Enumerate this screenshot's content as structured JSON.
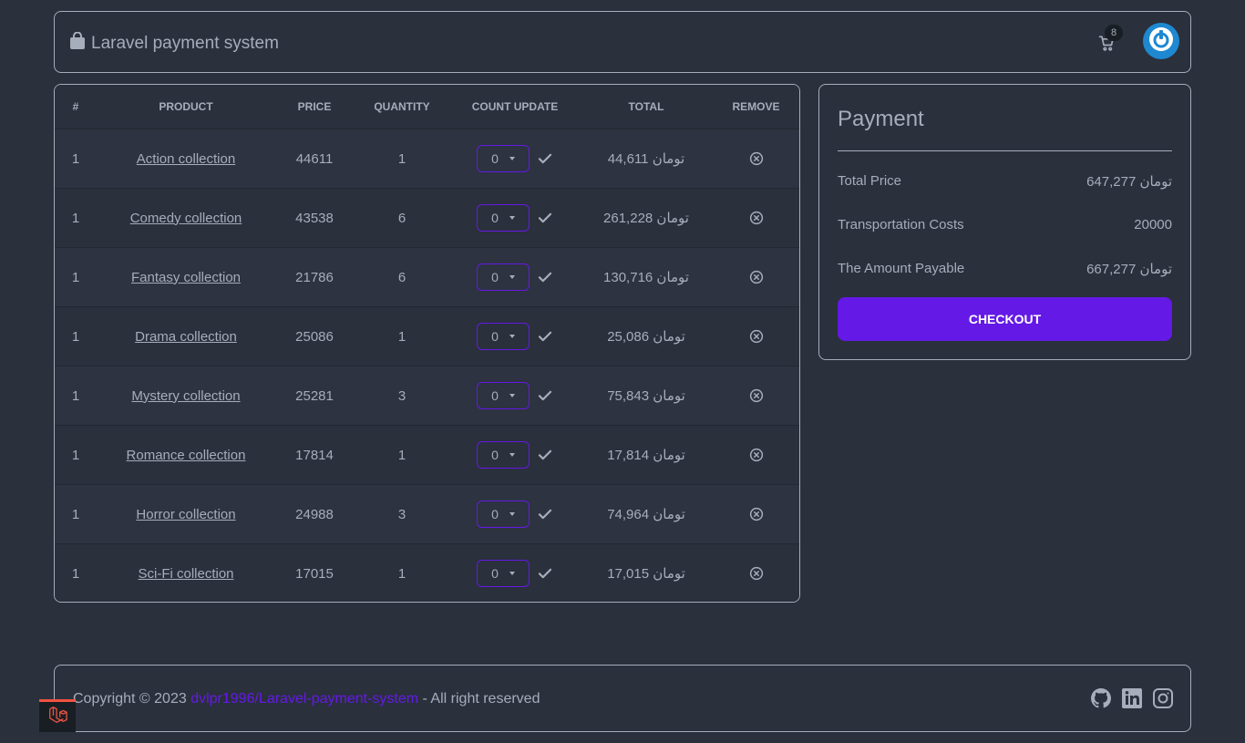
{
  "navbar": {
    "title": "Laravel payment system",
    "brand_icon": "shopping-bag-icon",
    "cart_count": "8",
    "cart_icon": "cart-icon",
    "avatar_icon": "power-icon"
  },
  "table": {
    "headers": [
      "#",
      "PRODUCT",
      "PRICE",
      "QUANTITY",
      "COUNT UPDATE",
      "TOTAL",
      "REMOVE"
    ],
    "rows": [
      {
        "num": "1",
        "product": "Action collection",
        "price": "44611",
        "quantity": "1",
        "count": "0",
        "total": "44,611 تومان"
      },
      {
        "num": "1",
        "product": "Comedy collection",
        "price": "43538",
        "quantity": "6",
        "count": "0",
        "total": "261,228 تومان"
      },
      {
        "num": "1",
        "product": "Fantasy collection",
        "price": "21786",
        "quantity": "6",
        "count": "0",
        "total": "130,716 تومان"
      },
      {
        "num": "1",
        "product": "Drama collection",
        "price": "25086",
        "quantity": "1",
        "count": "0",
        "total": "25,086 تومان"
      },
      {
        "num": "1",
        "product": "Mystery collection",
        "price": "25281",
        "quantity": "3",
        "count": "0",
        "total": "75,843 تومان"
      },
      {
        "num": "1",
        "product": "Romance collection",
        "price": "17814",
        "quantity": "1",
        "count": "0",
        "total": "17,814 تومان"
      },
      {
        "num": "1",
        "product": "Horror collection",
        "price": "24988",
        "quantity": "3",
        "count": "0",
        "total": "74,964 تومان"
      },
      {
        "num": "1",
        "product": "Sci-Fi collection",
        "price": "17015",
        "quantity": "1",
        "count": "0",
        "total": "17,015 تومان"
      }
    ]
  },
  "payment": {
    "title": "Payment",
    "total_price_label": "Total Price",
    "total_price_value": "647,277 تومان",
    "transport_label": "Transportation Costs",
    "transport_value": "20000",
    "payable_label": "The Amount Payable",
    "payable_value": "667,277 تومان",
    "checkout_label": "CHECKOUT"
  },
  "footer": {
    "copyright_prefix": "Copyright © 2023 ",
    "repo_link": "dvlpr1996/Laravel-payment-system",
    "copyright_suffix": " - All right reserved",
    "social_icons": [
      "github-icon",
      "linkedin-icon",
      "instagram-icon"
    ]
  },
  "colors": {
    "background": "#2a303c",
    "text": "#a6adbb",
    "accent": "#6419e6",
    "avatar": "#1e88d0",
    "laravel": "#f05340"
  }
}
